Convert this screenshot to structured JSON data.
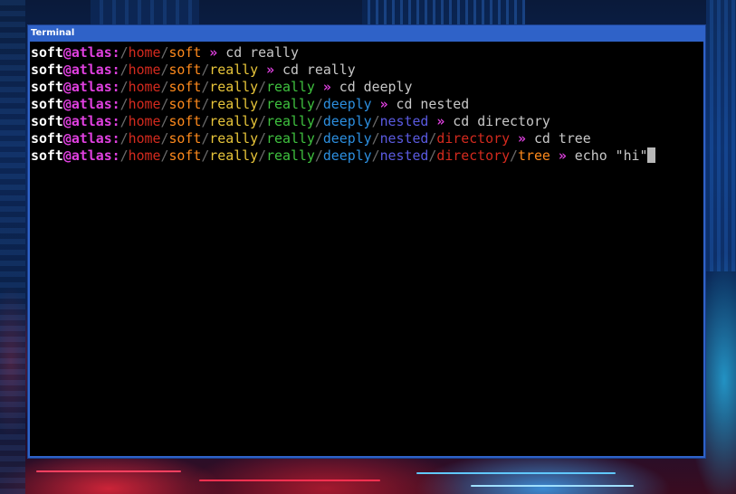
{
  "window": {
    "title": "Terminal"
  },
  "prompt": {
    "user": "soft",
    "at": "@",
    "host": "atlas",
    "colon": ":",
    "arrow": "»"
  },
  "colors": {
    "home": "#d42a1e",
    "soft": "#ff8a1c",
    "really1": "#e8c53a",
    "really2": "#3fc23f",
    "deeply": "#2c8fe0",
    "nested": "#5a5ae0",
    "directory": "#d42a1e",
    "tree": "#ff8a1c"
  },
  "lines": [
    {
      "path": [
        "home",
        "soft"
      ],
      "command": "cd really"
    },
    {
      "path": [
        "home",
        "soft",
        "really"
      ],
      "command": "cd really"
    },
    {
      "path": [
        "home",
        "soft",
        "really",
        "really"
      ],
      "command": "cd deeply"
    },
    {
      "path": [
        "home",
        "soft",
        "really",
        "really",
        "deeply"
      ],
      "command": "cd nested"
    },
    {
      "path": [
        "home",
        "soft",
        "really",
        "really",
        "deeply",
        "nested"
      ],
      "command": "cd directory"
    },
    {
      "path": [
        "home",
        "soft",
        "really",
        "really",
        "deeply",
        "nested",
        "directory"
      ],
      "command": "cd tree"
    },
    {
      "path": [
        "home",
        "soft",
        "really",
        "really",
        "deeply",
        "nested",
        "directory",
        "tree"
      ],
      "command": "echo \"hi\""
    }
  ]
}
